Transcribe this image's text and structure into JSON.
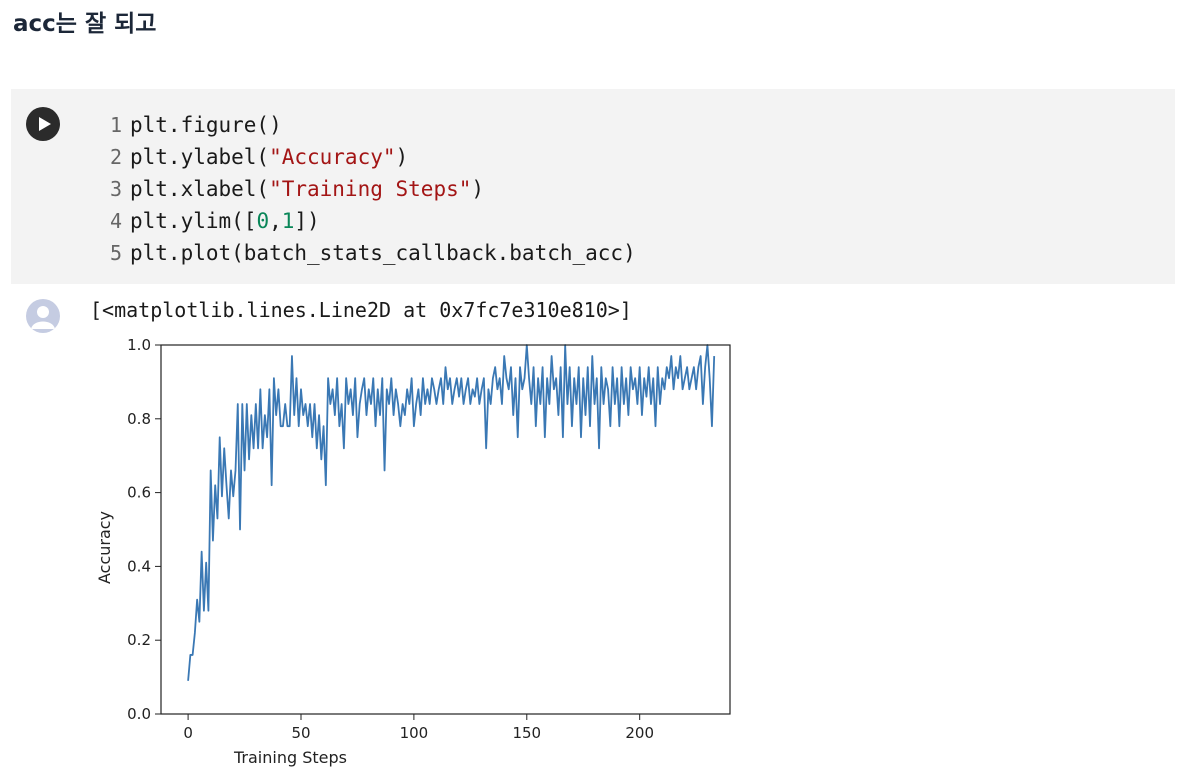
{
  "heading": "acc는 잘 되고",
  "code_cell": {
    "run_icon": "play-icon",
    "lines": [
      {
        "num": "1",
        "tokens": [
          {
            "t": "plt.figure()",
            "k": "plain"
          }
        ]
      },
      {
        "num": "2",
        "tokens": [
          {
            "t": "plt.ylabel(",
            "k": "plain"
          },
          {
            "t": "\"Accuracy\"",
            "k": "str"
          },
          {
            "t": ")",
            "k": "plain"
          }
        ]
      },
      {
        "num": "3",
        "tokens": [
          {
            "t": "plt.xlabel(",
            "k": "plain"
          },
          {
            "t": "\"Training Steps\"",
            "k": "str"
          },
          {
            "t": ")",
            "k": "plain"
          }
        ]
      },
      {
        "num": "4",
        "tokens": [
          {
            "t": "plt.ylim([",
            "k": "plain"
          },
          {
            "t": "0",
            "k": "num"
          },
          {
            "t": ",",
            "k": "plain"
          },
          {
            "t": "1",
            "k": "num"
          },
          {
            "t": "])",
            "k": "plain"
          }
        ]
      },
      {
        "num": "5",
        "tokens": [
          {
            "t": "plt.plot(batch_stats_callback.batch_acc)",
            "k": "plain"
          }
        ]
      }
    ]
  },
  "output": {
    "icon": "user-avatar-icon",
    "text": "[<matplotlib.lines.Line2D at 0x7fc7e310e810>]"
  },
  "colors": {
    "line": "#3a78b4",
    "string": "#a31515",
    "number": "#098658"
  },
  "chart_data": {
    "type": "line",
    "xlabel": "Training Steps",
    "ylabel": "Accuracy",
    "ylim": [
      0,
      1
    ],
    "xlim": [
      -12,
      240
    ],
    "xticks": [
      0,
      50,
      100,
      150,
      200
    ],
    "yticks": [
      "0.0",
      "0.2",
      "0.4",
      "0.6",
      "0.8",
      "1.0"
    ],
    "grid": false,
    "series": [
      {
        "values": [
          0.09,
          0.16,
          0.16,
          0.22,
          0.31,
          0.25,
          0.44,
          0.28,
          0.41,
          0.28,
          0.66,
          0.47,
          0.62,
          0.53,
          0.75,
          0.59,
          0.72,
          0.62,
          0.53,
          0.66,
          0.59,
          0.66,
          0.84,
          0.5,
          0.84,
          0.66,
          0.84,
          0.69,
          0.81,
          0.72,
          0.84,
          0.72,
          0.88,
          0.72,
          0.81,
          0.75,
          0.88,
          0.62,
          0.91,
          0.81,
          0.88,
          0.78,
          0.78,
          0.84,
          0.78,
          0.78,
          0.97,
          0.81,
          0.91,
          0.78,
          0.88,
          0.81,
          0.84,
          0.78,
          0.84,
          0.75,
          0.84,
          0.72,
          0.81,
          0.69,
          0.78,
          0.62,
          0.91,
          0.84,
          0.88,
          0.81,
          0.91,
          0.78,
          0.84,
          0.72,
          0.91,
          0.84,
          0.88,
          0.81,
          0.91,
          0.75,
          0.84,
          0.88,
          0.91,
          0.81,
          0.88,
          0.84,
          0.91,
          0.78,
          0.88,
          0.81,
          0.91,
          0.66,
          0.88,
          0.84,
          0.91,
          0.81,
          0.88,
          0.84,
          0.78,
          0.84,
          0.81,
          0.88,
          0.84,
          0.91,
          0.78,
          0.84,
          0.88,
          0.81,
          0.91,
          0.84,
          0.88,
          0.84,
          0.91,
          0.88,
          0.84,
          0.88,
          0.91,
          0.84,
          0.94,
          0.88,
          0.91,
          0.84,
          0.88,
          0.91,
          0.86,
          0.91,
          0.84,
          0.88,
          0.91,
          0.84,
          0.88,
          0.86,
          0.91,
          0.84,
          0.88,
          0.91,
          0.72,
          0.88,
          0.84,
          0.91,
          0.94,
          0.88,
          0.91,
          0.84,
          0.97,
          0.91,
          0.88,
          0.94,
          0.81,
          0.91,
          0.75,
          0.94,
          0.88,
          0.91,
          1.0,
          0.91,
          0.84,
          0.94,
          0.78,
          0.91,
          0.84,
          0.94,
          0.75,
          0.91,
          0.84,
          0.97,
          0.88,
          0.91,
          0.81,
          0.94,
          0.75,
          1.0,
          0.84,
          0.94,
          0.78,
          0.91,
          0.84,
          0.94,
          0.75,
          0.91,
          0.81,
          0.94,
          0.78,
          0.97,
          0.84,
          0.91,
          0.72,
          0.94,
          0.84,
          0.91,
          0.88,
          0.78,
          0.94,
          0.84,
          0.91,
          0.78,
          0.94,
          0.84,
          0.91,
          0.81,
          0.94,
          0.88,
          0.91,
          0.84,
          0.94,
          0.81,
          0.91,
          0.86,
          0.94,
          0.84,
          0.91,
          0.78,
          0.94,
          0.84,
          0.91,
          0.88,
          0.94,
          0.91,
          0.97,
          0.88,
          0.94,
          0.91,
          0.97,
          0.88,
          0.91,
          0.94,
          0.88,
          0.91,
          0.94,
          0.88,
          0.94,
          0.97,
          0.84,
          0.94,
          1.0,
          0.91,
          0.78,
          0.97
        ]
      }
    ]
  }
}
